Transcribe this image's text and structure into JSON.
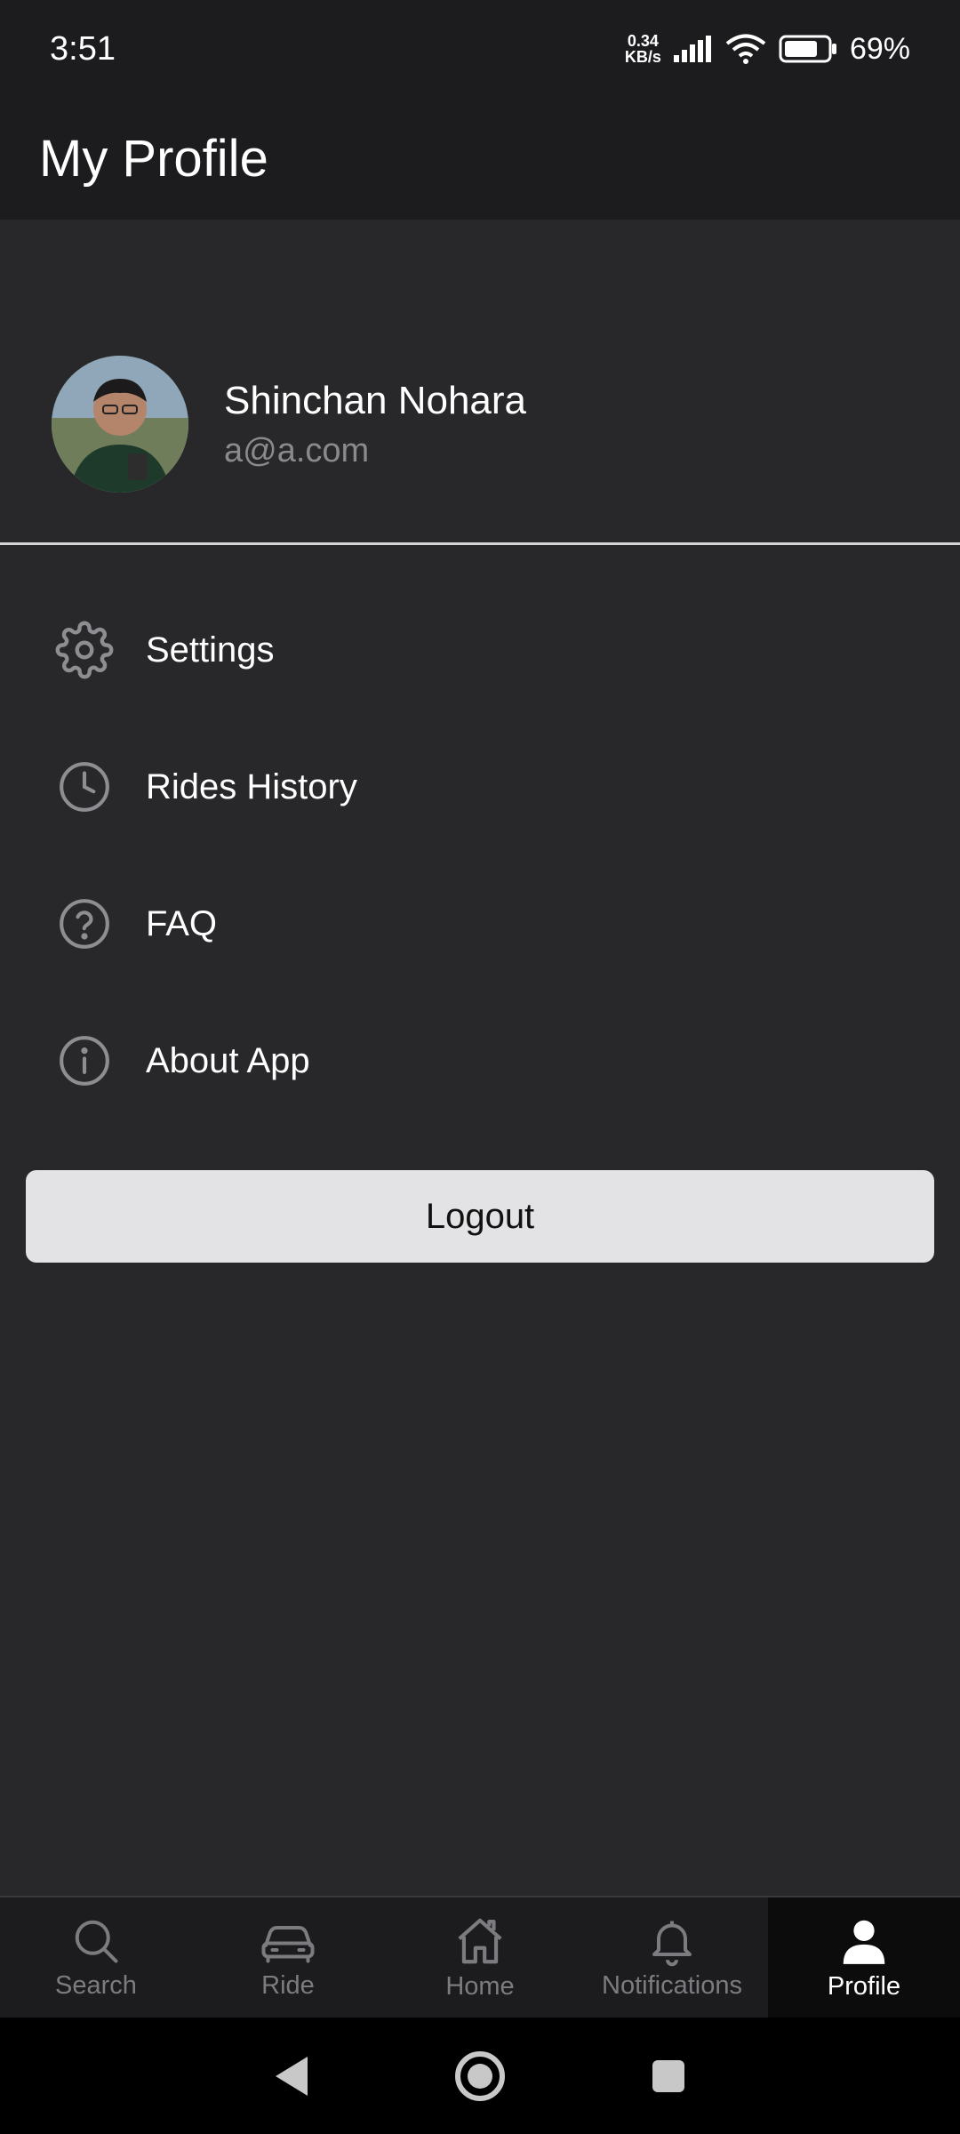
{
  "status_bar": {
    "time": "3:51",
    "speed_value": "0.34",
    "speed_unit": "KB/s",
    "battery": "69%"
  },
  "header": {
    "title": "My Profile"
  },
  "profile": {
    "name": "Shinchan Nohara",
    "email": "a@a.com"
  },
  "menu": {
    "items": [
      {
        "label": "Settings",
        "icon": "gear-icon"
      },
      {
        "label": "Rides History",
        "icon": "clock-icon"
      },
      {
        "label": "FAQ",
        "icon": "question-icon"
      },
      {
        "label": "About App",
        "icon": "info-icon"
      }
    ]
  },
  "logout_label": "Logout",
  "tabs": [
    {
      "label": "Search",
      "icon": "search-icon",
      "active": false
    },
    {
      "label": "Ride",
      "icon": "car-icon",
      "active": false
    },
    {
      "label": "Home",
      "icon": "home-icon",
      "active": false
    },
    {
      "label": "Notifications",
      "icon": "bell-icon",
      "active": false
    },
    {
      "label": "Profile",
      "icon": "person-icon",
      "active": true
    }
  ],
  "colors": {
    "background": "#28282a",
    "header": "#1c1c1e",
    "button": "#e3e3e5",
    "muted": "#8a8a8c"
  }
}
